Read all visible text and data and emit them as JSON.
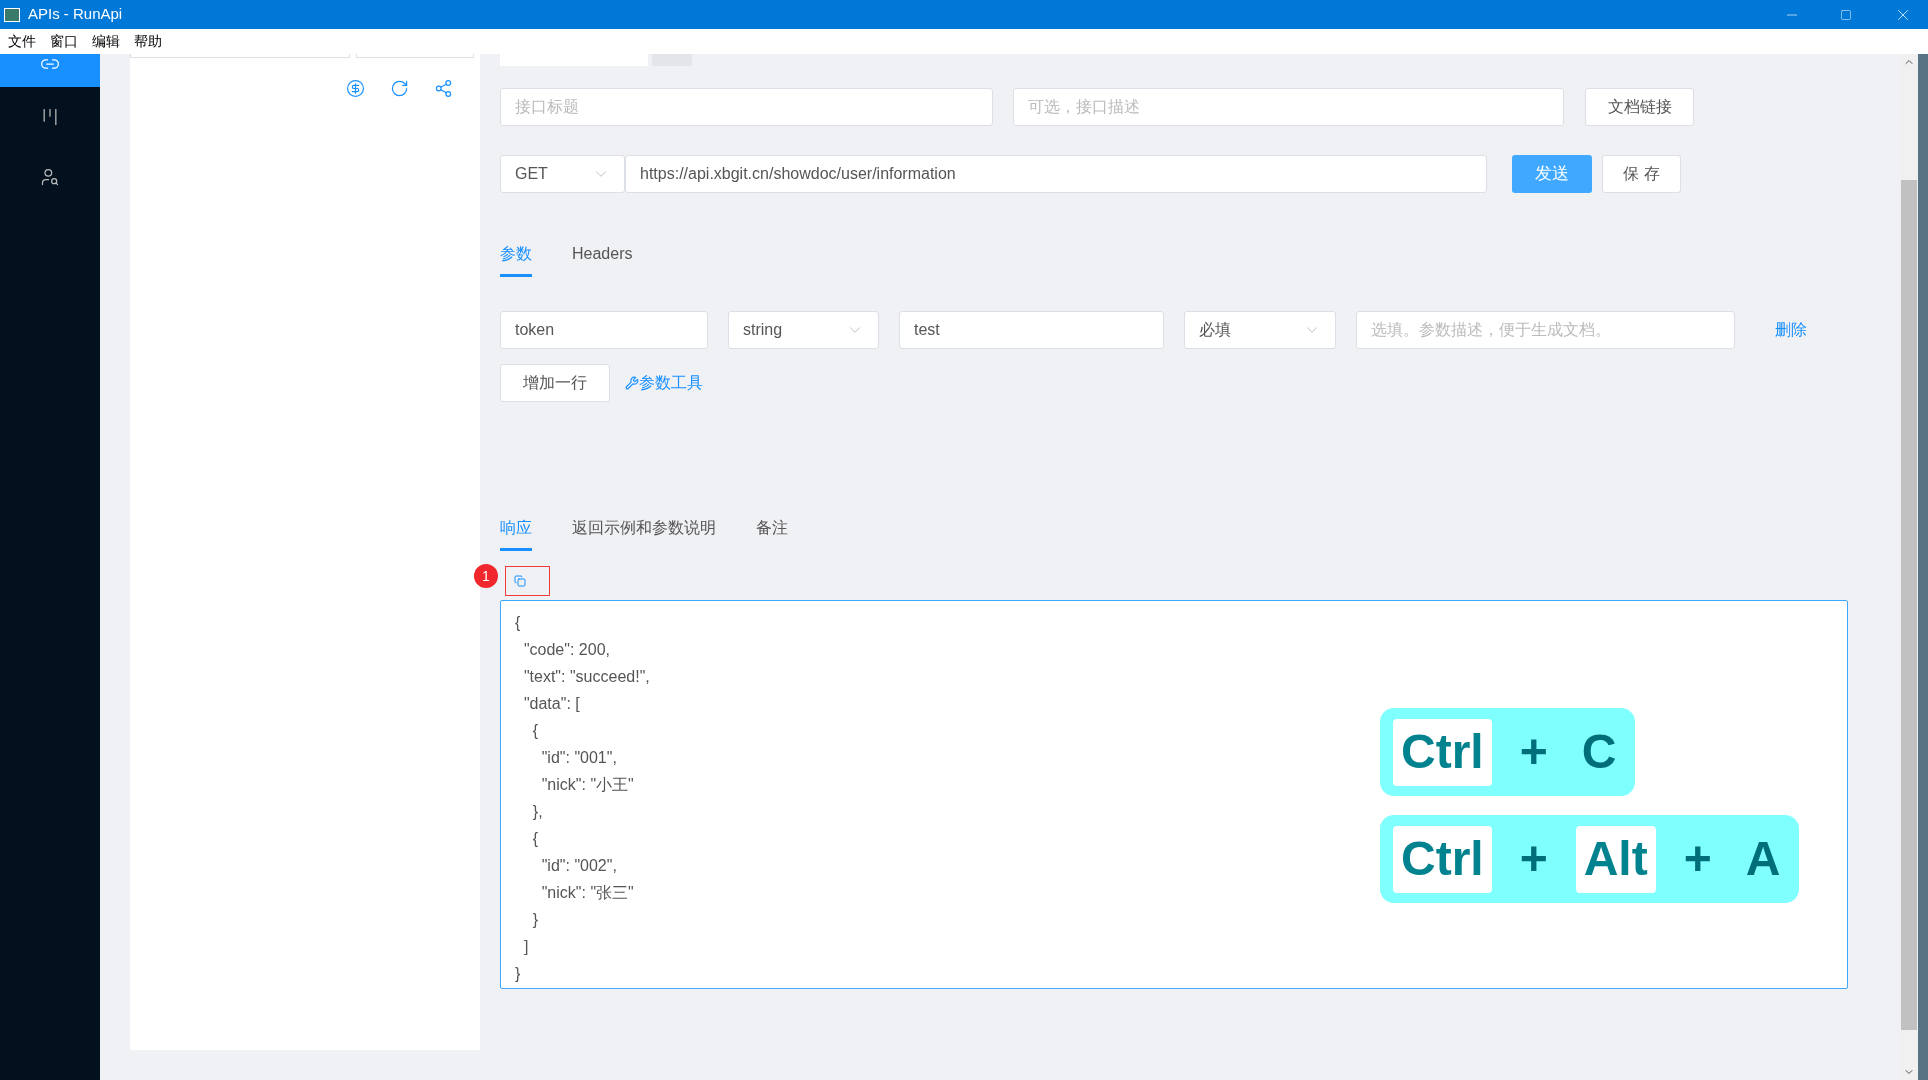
{
  "window": {
    "title": "APIs - RunApi"
  },
  "menu": [
    "文件",
    "窗口",
    "编辑",
    "帮助"
  ],
  "sidebar": {
    "items": [
      {
        "selected": true
      },
      {
        "selected": false
      },
      {
        "selected": false
      }
    ]
  },
  "api": {
    "title": {
      "placeholder": "接口标题"
    },
    "description": {
      "placeholder": "可选，接口描述"
    },
    "doc_link_button": "文档链接",
    "method": "GET",
    "url": "https://api.xbgit.cn/showdoc/user/information",
    "send_button": "发送",
    "save_button": "保 存"
  },
  "param_tabs": [
    {
      "label": "参数",
      "selected": true
    },
    {
      "label": "Headers",
      "selected": false
    }
  ],
  "params": [
    {
      "name": "token",
      "type": "string",
      "value": "test",
      "required": "必填",
      "description": {
        "placeholder": "选填。参数描述，便于生成文档。"
      },
      "delete": "删除"
    }
  ],
  "add_row_button": "增加一行",
  "param_tool_link": "参数工具",
  "response_tabs": [
    {
      "label": "响应",
      "selected": true
    },
    {
      "label": "返回示例和参数说明",
      "selected": false
    },
    {
      "label": "备注",
      "selected": false
    }
  ],
  "callout_badge": "1",
  "response_body": "{\n  \"code\": 200,\n  \"text\": \"succeed!\",\n  \"data\": [\n    {\n      \"id\": \"001\",\n      \"nick\": \"小王\"\n    },\n    {\n      \"id\": \"002\",\n      \"nick\": \"张三\"\n    }\n  ]\n}",
  "shortcuts": [
    {
      "keys": [
        {
          "label": "Ctrl",
          "boxed": true
        },
        {
          "label": "+",
          "boxed": false
        },
        {
          "label": "C",
          "boxed": false
        }
      ]
    },
    {
      "keys": [
        {
          "label": "Ctrl",
          "boxed": true
        },
        {
          "label": "+",
          "boxed": false
        },
        {
          "label": "Alt",
          "boxed": true
        },
        {
          "label": "+",
          "boxed": false
        },
        {
          "label": "A",
          "boxed": false
        }
      ]
    }
  ]
}
